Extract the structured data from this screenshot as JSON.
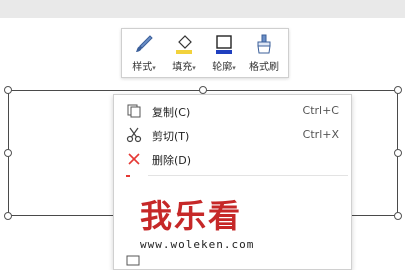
{
  "mini_toolbar": {
    "style_label": "样式",
    "fill_label": "填充",
    "outline_label": "轮廓",
    "format_painter_label": "格式刷",
    "dropdown_marker": "▾"
  },
  "context_menu": {
    "items": [
      {
        "label": "复制(C)",
        "shortcut": "Ctrl+C",
        "icon": "copy-icon"
      },
      {
        "label": "剪切(T)",
        "shortcut": "Ctrl+X",
        "icon": "scissors-icon"
      },
      {
        "label": "删除(D)",
        "shortcut": "",
        "icon": "delete-x-icon"
      }
    ]
  },
  "watermark": {
    "text": "我乐看",
    "url": "www.woleken.com"
  },
  "colors": {
    "accent": "#4472c4",
    "delete": "#e53935",
    "watermark": "#c62828"
  }
}
